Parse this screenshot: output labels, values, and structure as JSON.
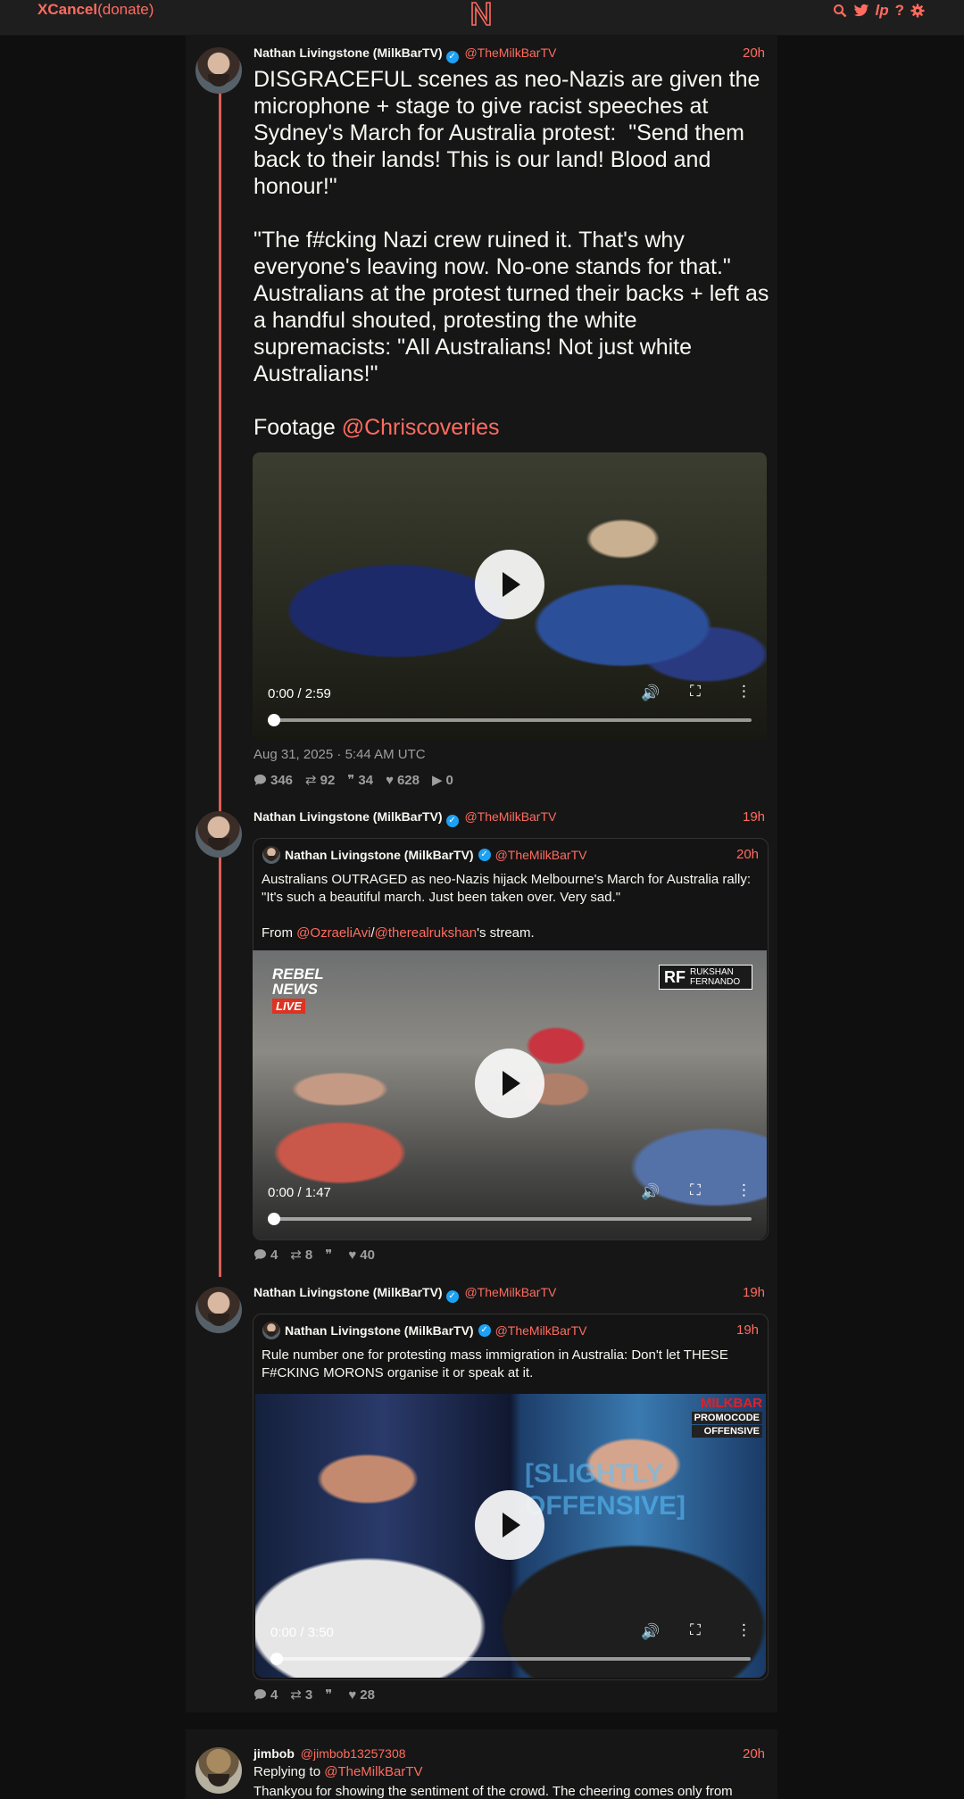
{
  "nav": {
    "brand_bold": "XCancel",
    "brand_donate": "(donate)",
    "logo_letter": "N",
    "icons": [
      "search-icon",
      "twitter-icon",
      "liberapay-icon",
      "help-icon",
      "gear-icon"
    ],
    "help_glyph": "?",
    "liberapay_glyph": "lp"
  },
  "colors": {
    "accent": "#ff6c60",
    "background": "#0f0f0f",
    "panel": "#161616",
    "verified": "#1da1f2"
  },
  "tweets": [
    {
      "name": "Nathan Livingstone (MilkBarTV)",
      "handle": "@TheMilkBarTV",
      "time": "20h",
      "text_main": "DISGRACEFUL scenes as neo-Nazis are given the microphone + stage to give racist speeches at Sydney's March for Australia protest:  \"Send them back to their lands! This is our land! Blood and honour!\"\n\n\"The f#cking Nazi crew ruined it. That's why everyone's leaving now. No-one stands for that.\" Australians at the protest turned their backs + left as a handful shouted, protesting the white supremacists: \"All Australians! Not just white Australians!\"\n\nFootage ",
      "footage_link": "@Chriscoveries",
      "video_time": "0:00 / 2:59",
      "date": "Aug 31, 2025 · 5:44 AM UTC",
      "stats": {
        "replies": "346",
        "retweets": "92",
        "quotes": "34",
        "likes": "628",
        "views": "0"
      }
    },
    {
      "name": "Nathan Livingstone (MilkBarTV)",
      "handle": "@TheMilkBarTV",
      "time": "19h",
      "quote": {
        "name": "Nathan Livingstone (MilkBarTV)",
        "handle": "@TheMilkBarTV",
        "time": "20h",
        "text": "Australians OUTRAGED as neo-Nazis hijack Melbourne's March for Australia rally: \"It's such a beautiful march. Just been taken over. Very sad.\"",
        "from_prefix": "From ",
        "from_link1": "@OzraeliAvi",
        "from_sep": "/",
        "from_link2": "@therealrukshan",
        "from_suffix": "'s stream.",
        "video_time": "0:00 / 1:47",
        "overlay_news": "REBEL NEWS",
        "overlay_live": "LIVE",
        "overlay_rf": "RF",
        "overlay_rf_name": "RUKSHAN FERNANDO"
      },
      "stats": {
        "replies": "4",
        "retweets": "8",
        "quotes": "",
        "likes": "40"
      }
    },
    {
      "name": "Nathan Livingstone (MilkBarTV)",
      "handle": "@TheMilkBarTV",
      "time": "19h",
      "quote": {
        "name": "Nathan Livingstone (MilkBarTV)",
        "handle": "@TheMilkBarTV",
        "time": "19h",
        "text": "Rule number one for protesting mass immigration in Australia: Don't let THESE F#CKING MORONS organise it or speak at it.",
        "video_time": "0:00 / 3:50",
        "overlay_brand": "MILKBAR",
        "overlay_promo": "PROMOCODE",
        "overlay_offensive": "OFFENSIVE",
        "overlay_show": "[SLIGHTLY OFFENSIVE]"
      },
      "stats": {
        "replies": "4",
        "retweets": "3",
        "quotes": "",
        "likes": "28"
      }
    }
  ],
  "reply": {
    "name": "jimbob",
    "handle": "@jimbob13257308",
    "time": "20h",
    "replying_to_prefix": "Replying to ",
    "replying_to": "@TheMilkBarTV",
    "text": "Thankyou for showing the sentiment of the crowd. The cheering comes only from"
  }
}
